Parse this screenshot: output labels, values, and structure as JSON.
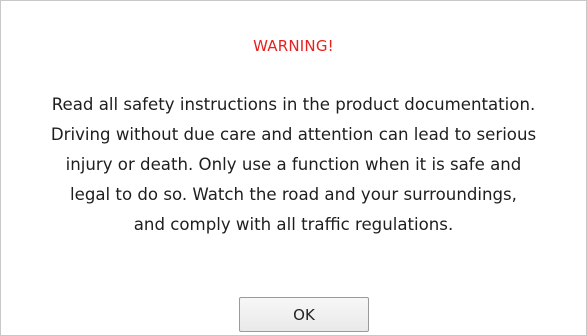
{
  "dialog": {
    "title": "WARNING!",
    "title_color": "#e6221e",
    "message_lines": [
      "Read all safety instructions in the product documentation.",
      "Driving without due care and attention can lead to serious",
      "injury or death. Only use a function when it is safe and",
      "legal to do so. Watch the road and your surroundings,",
      "and comply with all traffic regulations."
    ],
    "ok_label": "OK"
  }
}
